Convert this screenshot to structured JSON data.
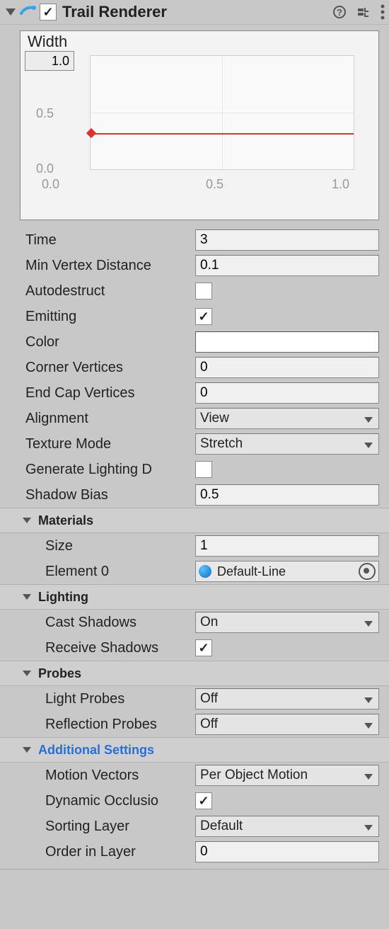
{
  "header": {
    "title": "Trail Renderer",
    "enabled": true
  },
  "curve": {
    "title": "Width",
    "y_input": "1.0",
    "y_ticks": [
      "0.5",
      "0.0"
    ],
    "x_ticks": [
      "0.0",
      "0.5",
      "1.0"
    ]
  },
  "props": {
    "time": {
      "label": "Time",
      "value": "3"
    },
    "minVert": {
      "label": "Min Vertex Distance",
      "value": "0.1"
    },
    "autodestruct": {
      "label": "Autodestruct",
      "checked": false
    },
    "emitting": {
      "label": "Emitting",
      "checked": true
    },
    "color": {
      "label": "Color"
    },
    "cornerVerts": {
      "label": "Corner Vertices",
      "value": "0"
    },
    "endCapVerts": {
      "label": "End Cap Vertices",
      "value": "0"
    },
    "alignment": {
      "label": "Alignment",
      "value": "View"
    },
    "texMode": {
      "label": "Texture Mode",
      "value": "Stretch"
    },
    "genLight": {
      "label": "Generate Lighting D",
      "checked": false
    },
    "shadowBias": {
      "label": "Shadow Bias",
      "value": "0.5"
    }
  },
  "materials": {
    "header": "Materials",
    "size": {
      "label": "Size",
      "value": "1"
    },
    "el0": {
      "label": "Element 0",
      "value": "Default-Line"
    }
  },
  "lighting": {
    "header": "Lighting",
    "cast": {
      "label": "Cast Shadows",
      "value": "On"
    },
    "receive": {
      "label": "Receive Shadows",
      "checked": true
    }
  },
  "probes": {
    "header": "Probes",
    "light": {
      "label": "Light Probes",
      "value": "Off"
    },
    "refl": {
      "label": "Reflection Probes",
      "value": "Off"
    }
  },
  "additional": {
    "header": "Additional Settings",
    "motion": {
      "label": "Motion Vectors",
      "value": "Per Object Motion"
    },
    "dynOcc": {
      "label": "Dynamic Occlusio",
      "checked": true
    },
    "sortLayer": {
      "label": "Sorting Layer",
      "value": "Default"
    },
    "orderLayer": {
      "label": "Order in Layer",
      "value": "0"
    }
  },
  "chart_data": {
    "type": "line",
    "title": "Width",
    "x": [
      0.0,
      1.0
    ],
    "values": [
      0.33,
      0.33
    ],
    "xlim": [
      0.0,
      1.0
    ],
    "ylim": [
      0.0,
      1.0
    ],
    "xlabel": "",
    "ylabel": ""
  }
}
